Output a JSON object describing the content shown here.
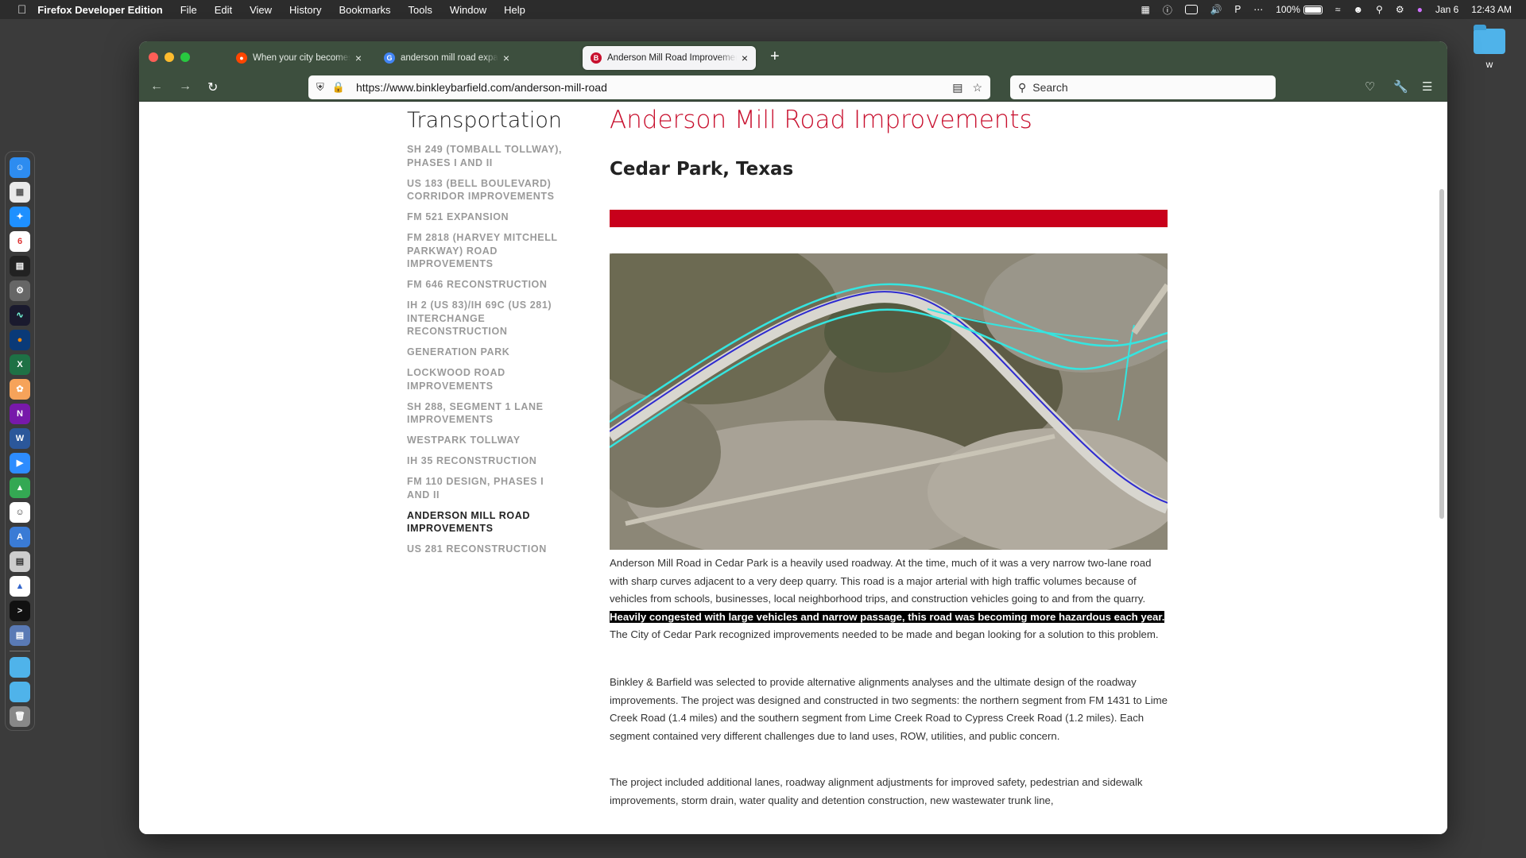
{
  "menubar": {
    "app_name": "Firefox Developer Edition",
    "items": [
      "File",
      "Edit",
      "View",
      "History",
      "Bookmarks",
      "Tools",
      "Window",
      "Help"
    ],
    "battery": "100%",
    "date": "Jan 6",
    "time": "12:43 AM"
  },
  "desktop": {
    "folder_label": "w"
  },
  "tabs": [
    {
      "title": "When your city becomes a Desti",
      "favicon_color": "#ff4500"
    },
    {
      "title": "anderson mill road expansion ce",
      "favicon_color": "#4285f4"
    },
    {
      "title": "Anderson Mill Road Improvement",
      "favicon_color": "#c8102e"
    }
  ],
  "url": "https://www.binkleybarfield.com/anderson-mill-road",
  "search_placeholder": "Search",
  "sidebar": {
    "title": "Transportation",
    "items": [
      "SH 249 (TOMBALL TOLLWAY), PHASES I AND II",
      "US 183 (BELL BOULEVARD) CORRIDOR IMPROVEMENTS",
      "FM 521 EXPANSION",
      "FM 2818 (HARVEY MITCHELL PARKWAY) ROAD IMPROVEMENTS",
      "FM 646 RECONSTRUCTION",
      "IH 2 (US 83)/IH 69C (US 281) INTERCHANGE RECONSTRUCTION",
      "GENERATION PARK",
      "LOCKWOOD ROAD IMPROVEMENTS",
      "SH 288, SEGMENT 1 LANE IMPROVEMENTS",
      "WESTPARK TOLLWAY",
      "IH 35 RECONSTRUCTION",
      "FM 110 DESIGN, PHASES I AND II",
      "ANDERSON MILL ROAD IMPROVEMENTS",
      "US 281 RECONSTRUCTION"
    ],
    "current_index": 12
  },
  "article": {
    "title": "Anderson Mill Road Improvements",
    "location": "Cedar Park, Texas",
    "p1_before": "Anderson Mill Road in Cedar Park is a heavily used roadway. At the time, much of it was a very narrow two-lane road with sharp curves adjacent to a very deep quarry. This road is a major arterial with high traffic volumes because of vehicles from schools, businesses, local neighborhood trips, and construction vehicles going to and from the quarry. ",
    "p1_highlight": "Heavily congested with large vehicles and narrow passage, this road was becoming more hazardous each year.",
    "p1_after": " The City of Cedar Park recognized improvements needed to be made and began looking for a solution to this problem.",
    "p2": "Binkley & Barfield was selected to provide alternative alignments analyses and the ultimate design of the roadway improvements. The project was designed and constructed in two segments: the northern segment from FM 1431 to Lime Creek Road (1.4 miles) and the southern segment from Lime Creek Road to Cypress Creek Road (1.2 miles). Each segment contained very different challenges due to land uses, ROW, utilities, and public concern.",
    "p3": "The project included additional lanes, roadway alignment adjustments for improved safety, pedestrian and sidewalk improvements, storm drain, water quality and detention construction, new wastewater trunk line,"
  }
}
